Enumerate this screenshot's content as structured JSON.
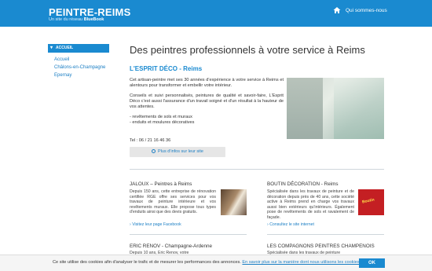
{
  "header": {
    "logo_title": "PEINTRE-REIMS",
    "logo_sub_prefix": "Un site du réseau ",
    "logo_sub_brand": "BlueBook",
    "nav_who": "Qui sommes-nous",
    "accent": "#1a8ad0"
  },
  "sidebar": {
    "head": "ACCUEIL",
    "items": [
      {
        "label": "Accueil"
      },
      {
        "label": "Châlons-en-Champagne"
      },
      {
        "label": "Epernay"
      }
    ]
  },
  "main": {
    "title": "Des peintres professionnels à votre service à Reims",
    "featured": {
      "name": "L'ESPRIT DÉCO - Reims",
      "p1": "Cet artisan-peintre met ses 30 années d'expérience à votre service à Reims et alentours pour transformer et embellir votre intérieur.",
      "p2": "Conseils et suivi personnalisés, peintures de qualité et savoir-faire, L'Esprit Déco c'est aussi l'assurance d'un travail soigné et d'un résultat à la hauteur de vos attentes.",
      "p3a": "- revêtements de sols et muraux",
      "p3b": "- enduits et moulures décoratives",
      "phone": "Tel : 06 / 21 16 46 36",
      "more": "Plus d'infos sur leur site"
    },
    "cards": [
      {
        "title": "JALOUX – Peintres à Reims",
        "text": "Depuis 150 ans, cette entreprise de rénovation certifiée RGE offre ses services pour vos travaux de peinture intérieure et vos revêtements muraux. Elle propose tous types d'enduits ainsi que des devis gratuits.",
        "link": "Visitez leur page Facebook"
      },
      {
        "title": "BOUTIN DÉCORATION - Reims",
        "text": "Spécialisée dans les travaux de peinture et de décoration depuis près de 40 ans, cette société active à Reims prend en charge vos travaux aussi bien extérieurs qu'intérieurs. Également pose de revêtements de sols et ravalement de façade.",
        "link": "Consultez le site internet",
        "img_text": "Boutin"
      },
      {
        "title": "ERIC RENOV - Champagne-Ardenne",
        "text": "Depuis 10 ans, Eric Renov, votre",
        "link": ""
      },
      {
        "title": "LES COMPAGNONS PEINTRES CHAMPENOIS",
        "text": "Spécialisée dans les travaux de peinture",
        "link": ""
      }
    ]
  },
  "cookie": {
    "text": "Ce site utilise des cookies afin d'analyser le trafic et de mesurer les performances des annonces.",
    "link": "En savoir plus sur la manière dont nous utilisons les cookies.",
    "ok": "OK"
  }
}
